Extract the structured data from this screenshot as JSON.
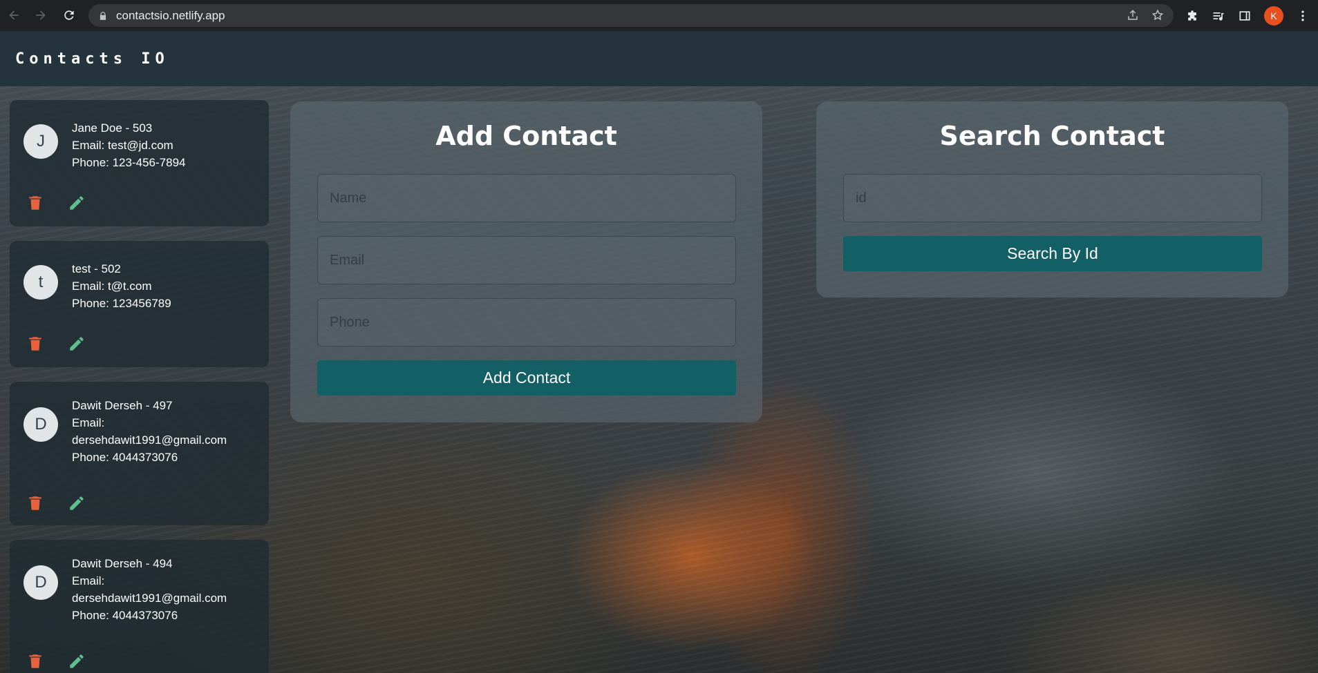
{
  "browser": {
    "url": "contactsio.netlify.app",
    "profile_initial": "K"
  },
  "app": {
    "brand": "Contacts IO"
  },
  "contacts": [
    {
      "initial": "J",
      "title": "Jane Doe - 503",
      "email_line": "Email: test@jd.com",
      "email_line2": "",
      "phone_line": "Phone: 123-456-7894"
    },
    {
      "initial": "t",
      "title": "test - 502",
      "email_line": "Email: t@t.com",
      "email_line2": "",
      "phone_line": "Phone: 123456789"
    },
    {
      "initial": "D",
      "title": "Dawit Derseh - 497",
      "email_line": "Email:",
      "email_line2": "dersehdawit1991@gmail.com",
      "phone_line": "Phone: 4044373076"
    },
    {
      "initial": "D",
      "title": "Dawit Derseh - 494",
      "email_line": "Email:",
      "email_line2": "dersehdawit1991@gmail.com",
      "phone_line": "Phone: 4044373076"
    }
  ],
  "add_panel": {
    "heading": "Add Contact",
    "name_placeholder": "Name",
    "email_placeholder": "Email",
    "phone_placeholder": "Phone",
    "button_label": "Add Contact"
  },
  "search_panel": {
    "heading": "Search Contact",
    "id_placeholder": "id",
    "button_label": "Search By Id"
  },
  "colors": {
    "accent": "#135f66",
    "delete_icon": "#e8623d",
    "edit_icon": "#5fbf8c",
    "topbar": "#25343c"
  },
  "icons": {
    "delete": "trash-icon",
    "edit": "pencil-icon"
  }
}
